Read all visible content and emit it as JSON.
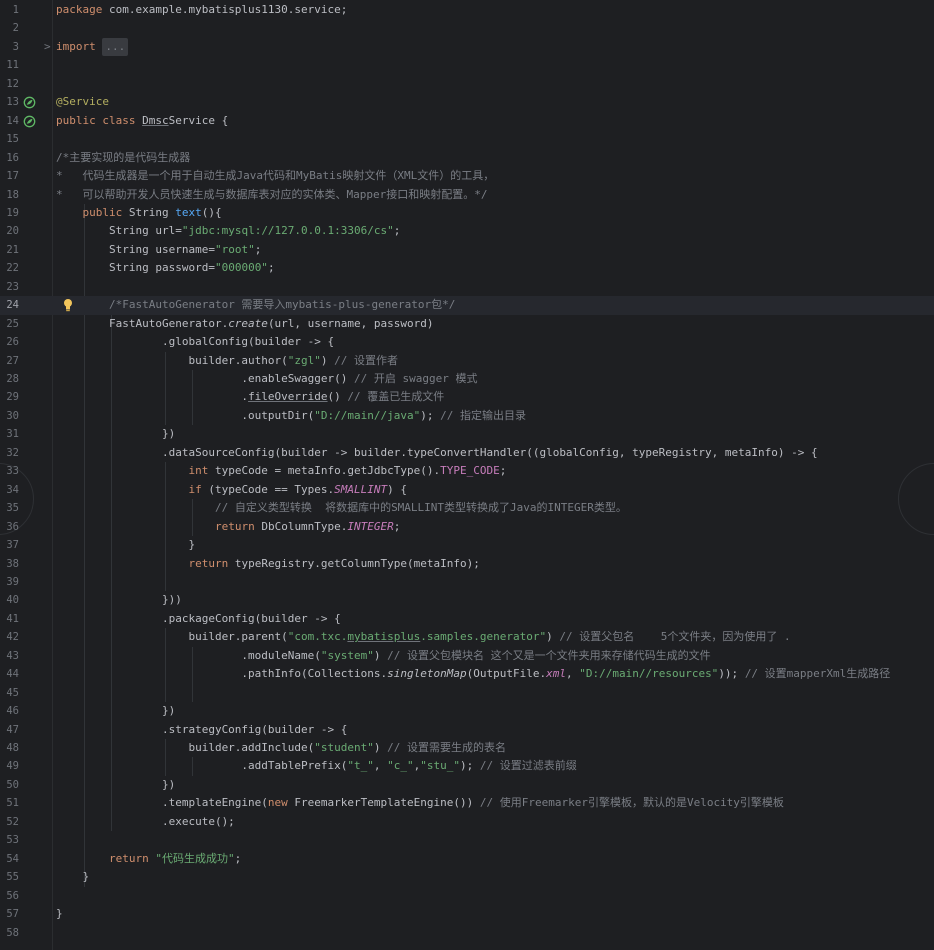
{
  "editor": {
    "lines": [
      {
        "n": "1",
        "segs": [
          {
            "t": "package",
            "c": "kw"
          },
          {
            "t": " com.example.mybatisplus1130.service;"
          }
        ]
      },
      {
        "n": "2",
        "segs": []
      },
      {
        "n": "3",
        "fold": ">",
        "segs": [
          {
            "t": "import",
            "c": "kw"
          },
          {
            "t": " "
          },
          {
            "t": "...",
            "c": "fold"
          }
        ]
      },
      {
        "n": "11",
        "segs": []
      },
      {
        "n": "12",
        "segs": []
      },
      {
        "n": "13",
        "icon": "spring-bean-icon",
        "segs": [
          {
            "t": "@Service",
            "c": "ann"
          }
        ]
      },
      {
        "n": "14",
        "icon": "spring-bean-icon",
        "segs": [
          {
            "t": "public class",
            "c": "kw"
          },
          {
            "t": " "
          },
          {
            "t": "Dmsc",
            "c": "under"
          },
          {
            "t": "Service {"
          }
        ]
      },
      {
        "n": "15",
        "segs": []
      },
      {
        "n": "16",
        "segs": [
          {
            "t": "/*主要实现的是代码生成器",
            "c": "cmt"
          }
        ]
      },
      {
        "n": "17",
        "segs": [
          {
            "t": "*   代码生成器是一个用于自动生成Java代码和MyBatis映射文件（XML文件）的工具，",
            "c": "cmt"
          }
        ]
      },
      {
        "n": "18",
        "segs": [
          {
            "t": "*   可以帮助开发人员快速生成与数据库表对应的实体类、Mapper接口和映射配置。*/",
            "c": "cmt"
          }
        ]
      },
      {
        "n": "19",
        "segs": [
          {
            "t": "    "
          },
          {
            "t": "public",
            "c": "kw"
          },
          {
            "t": " String "
          },
          {
            "t": "text",
            "c": "fn"
          },
          {
            "t": "(){"
          }
        ]
      },
      {
        "n": "20",
        "segs": [
          {
            "t": "        String url="
          },
          {
            "t": "\"jdbc:mysql://127.0.0.1:3306/cs\"",
            "c": "str"
          },
          {
            "t": ";"
          }
        ]
      },
      {
        "n": "21",
        "segs": [
          {
            "t": "        String username="
          },
          {
            "t": "\"root\"",
            "c": "str"
          },
          {
            "t": ";"
          }
        ]
      },
      {
        "n": "22",
        "segs": [
          {
            "t": "        String password="
          },
          {
            "t": "\"000000\"",
            "c": "str"
          },
          {
            "t": ";"
          }
        ]
      },
      {
        "n": "23",
        "segs": []
      },
      {
        "n": "24",
        "current": true,
        "icon": "lightbulb-icon",
        "segs": [
          {
            "t": "        "
          },
          {
            "t": "/*FastAutoGenerator 需要导入mybatis-plus-generator包*/",
            "c": "cmt"
          }
        ]
      },
      {
        "n": "25",
        "segs": [
          {
            "t": "        FastAutoGenerator."
          },
          {
            "t": "create",
            "c": "ital"
          },
          {
            "t": "(url, username, password)"
          }
        ]
      },
      {
        "n": "26",
        "segs": [
          {
            "t": "                .globalConfig(builder -> {"
          }
        ]
      },
      {
        "n": "27",
        "segs": [
          {
            "t": "                    builder.author("
          },
          {
            "t": "\"zgl\"",
            "c": "str"
          },
          {
            "t": ") "
          },
          {
            "t": "// 设置作者",
            "c": "cmt"
          }
        ]
      },
      {
        "n": "28",
        "segs": [
          {
            "t": "                            .enableSwagger() "
          },
          {
            "t": "// 开启 swagger 模式",
            "c": "cmt"
          }
        ]
      },
      {
        "n": "29",
        "segs": [
          {
            "t": "                            ."
          },
          {
            "t": "fileOverride",
            "c": "under"
          },
          {
            "t": "() "
          },
          {
            "t": "// 覆盖已生成文件",
            "c": "cmt"
          }
        ]
      },
      {
        "n": "30",
        "segs": [
          {
            "t": "                            .outputDir("
          },
          {
            "t": "\"D://main//java\"",
            "c": "str"
          },
          {
            "t": "); "
          },
          {
            "t": "// 指定输出目录",
            "c": "cmt"
          }
        ]
      },
      {
        "n": "31",
        "segs": [
          {
            "t": "                })"
          }
        ]
      },
      {
        "n": "32",
        "segs": [
          {
            "t": "                .dataSourceConfig(builder -> builder.typeConvertHandler((globalConfig, typeRegistry, metaInfo) -> {"
          }
        ]
      },
      {
        "n": "33",
        "segs": [
          {
            "t": "                    "
          },
          {
            "t": "int",
            "c": "kw"
          },
          {
            "t": " typeCode = metaInfo.getJdbcType()."
          },
          {
            "t": "TYPE_CODE",
            "c": "fld"
          },
          {
            "t": ";"
          }
        ]
      },
      {
        "n": "34",
        "segs": [
          {
            "t": "                    "
          },
          {
            "t": "if",
            "c": "kw"
          },
          {
            "t": " (typeCode == Types."
          },
          {
            "t": "SMALLINT",
            "c": "ifld"
          },
          {
            "t": ") {"
          }
        ]
      },
      {
        "n": "35",
        "segs": [
          {
            "t": "                        "
          },
          {
            "t": "// 自定义类型转换  将数据库中的SMALLINT类型转换成了Java的INTEGER类型。",
            "c": "cmt"
          }
        ]
      },
      {
        "n": "36",
        "segs": [
          {
            "t": "                        "
          },
          {
            "t": "return",
            "c": "kw"
          },
          {
            "t": " DbColumnType."
          },
          {
            "t": "INTEGER",
            "c": "ifld"
          },
          {
            "t": ";"
          }
        ]
      },
      {
        "n": "37",
        "segs": [
          {
            "t": "                    }"
          }
        ]
      },
      {
        "n": "38",
        "segs": [
          {
            "t": "                    "
          },
          {
            "t": "return",
            "c": "kw"
          },
          {
            "t": " typeRegistry.getColumnType(metaInfo);"
          }
        ]
      },
      {
        "n": "39",
        "segs": []
      },
      {
        "n": "40",
        "segs": [
          {
            "t": "                }))"
          }
        ]
      },
      {
        "n": "41",
        "segs": [
          {
            "t": "                .packageConfig(builder -> {"
          }
        ]
      },
      {
        "n": "42",
        "segs": [
          {
            "t": "                    builder.parent("
          },
          {
            "t": "\"com.txc.",
            "c": "str"
          },
          {
            "t": "mybatisplus",
            "c": "strunder"
          },
          {
            "t": ".samples.generator\"",
            "c": "str"
          },
          {
            "t": ") "
          },
          {
            "t": "// 设置父包名    5个文件夹，因为使用了 .",
            "c": "cmt"
          }
        ]
      },
      {
        "n": "43",
        "segs": [
          {
            "t": "                            .moduleName("
          },
          {
            "t": "\"system\"",
            "c": "str"
          },
          {
            "t": ") "
          },
          {
            "t": "// 设置父包模块名 这个又是一个文件夹用来存储代码生成的文件",
            "c": "cmt"
          }
        ]
      },
      {
        "n": "44",
        "segs": [
          {
            "t": "                            .pathInfo(Collections."
          },
          {
            "t": "singletonMap",
            "c": "ital"
          },
          {
            "t": "(OutputFile."
          },
          {
            "t": "xml",
            "c": "ifld"
          },
          {
            "t": ", "
          },
          {
            "t": "\"D://main//resources\"",
            "c": "str"
          },
          {
            "t": ")); "
          },
          {
            "t": "// 设置mapperXml生成路径",
            "c": "cmt"
          }
        ]
      },
      {
        "n": "45",
        "segs": []
      },
      {
        "n": "46",
        "segs": [
          {
            "t": "                })"
          }
        ]
      },
      {
        "n": "47",
        "segs": [
          {
            "t": "                .strategyConfig(builder -> {"
          }
        ]
      },
      {
        "n": "48",
        "segs": [
          {
            "t": "                    builder.addInclude("
          },
          {
            "t": "\"student\"",
            "c": "str"
          },
          {
            "t": ") "
          },
          {
            "t": "// 设置需要生成的表名",
            "c": "cmt"
          }
        ]
      },
      {
        "n": "49",
        "segs": [
          {
            "t": "                            .addTablePrefix("
          },
          {
            "t": "\"t_\"",
            "c": "str"
          },
          {
            "t": ", "
          },
          {
            "t": "\"c_\"",
            "c": "str"
          },
          {
            "t": ","
          },
          {
            "t": "\"stu_\"",
            "c": "str"
          },
          {
            "t": "); "
          },
          {
            "t": "// 设置过滤表前缀",
            "c": "cmt"
          }
        ]
      },
      {
        "n": "50",
        "segs": [
          {
            "t": "                })"
          }
        ]
      },
      {
        "n": "51",
        "segs": [
          {
            "t": "                .templateEngine("
          },
          {
            "t": "new",
            "c": "kw"
          },
          {
            "t": " FreemarkerTemplateEngine()) "
          },
          {
            "t": "// 使用Freemarker引擎模板，默认的是Velocity引擎模板",
            "c": "cmt"
          }
        ]
      },
      {
        "n": "52",
        "segs": [
          {
            "t": "                .execute();"
          }
        ]
      },
      {
        "n": "53",
        "segs": []
      },
      {
        "n": "54",
        "segs": [
          {
            "t": "        "
          },
          {
            "t": "return",
            "c": "kw"
          },
          {
            "t": " "
          },
          {
            "t": "\"代码生成成功\"",
            "c": "str"
          },
          {
            "t": ";"
          }
        ]
      },
      {
        "n": "55",
        "segs": [
          {
            "t": "    }"
          }
        ]
      },
      {
        "n": "56",
        "segs": []
      },
      {
        "n": "57",
        "segs": [
          {
            "t": "}"
          }
        ]
      },
      {
        "n": "58",
        "segs": []
      }
    ]
  }
}
